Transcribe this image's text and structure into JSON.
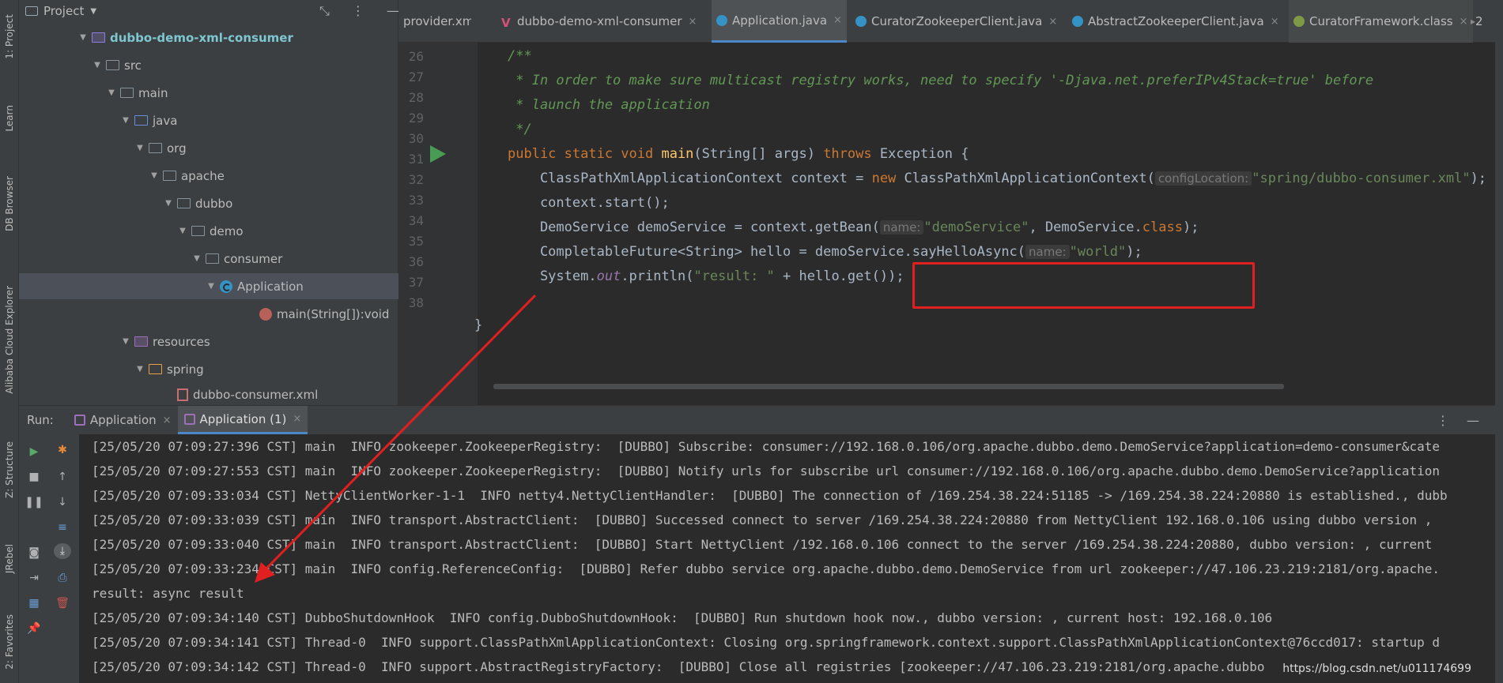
{
  "left_strip": {
    "tabs": [
      "1: Project",
      "Learn",
      "DB Browser",
      "Alibaba Cloud Explorer",
      "Z: Structure",
      "JRebel",
      "2: Favorites"
    ]
  },
  "project": {
    "title": "Project",
    "tree": [
      {
        "label": "dubbo-demo-xml-consumer",
        "kind": "module"
      },
      {
        "label": "src",
        "kind": "folder"
      },
      {
        "label": "main",
        "kind": "folder"
      },
      {
        "label": "java",
        "kind": "blue"
      },
      {
        "label": "org",
        "kind": "folder"
      },
      {
        "label": "apache",
        "kind": "folder"
      },
      {
        "label": "dubbo",
        "kind": "folder"
      },
      {
        "label": "demo",
        "kind": "folder"
      },
      {
        "label": "consumer",
        "kind": "folder"
      },
      {
        "label": "Application",
        "kind": "class"
      },
      {
        "label": "main(String[]):void",
        "kind": "method"
      },
      {
        "label": "resources",
        "kind": "resources"
      },
      {
        "label": "spring",
        "kind": "orange"
      },
      {
        "label": "dubbo-consumer.xml",
        "kind": "xml"
      }
    ]
  },
  "editor": {
    "tabs": [
      {
        "label": "provider.xml",
        "active": false
      },
      {
        "label": "dubbo-demo-xml-consumer",
        "active": false
      },
      {
        "label": "Application.java",
        "active": true
      },
      {
        "label": "CuratorZookeeperClient.java",
        "active": false
      },
      {
        "label": "AbstractZookeeperClient.java",
        "active": false
      },
      {
        "label": "CuratorFramework.class",
        "active": false
      }
    ],
    "overflow_label": "2",
    "line_numbers": [
      "26",
      "27",
      "28",
      "29",
      "30",
      "31",
      "32",
      "33",
      "34",
      "35",
      "36",
      "37",
      "38"
    ],
    "code": {
      "l26": "/**",
      "l27": " * In order to make sure multicast registry works, need to specify '-Djava.net.preferIPv4Stack=true' before",
      "l28": " * launch the application",
      "l29": " */",
      "l30_kw": "public static void ",
      "l30_fn": "main",
      "l30_rest": "(String[] args) ",
      "l30_kw2": "throws ",
      "l30_end": "Exception {",
      "l31_a": "    ClassPathXmlApplicationContext context = ",
      "l31_kw": "new ",
      "l31_b": "ClassPathXmlApplicationContext(",
      "l31_hint": "configLocation:",
      "l31_str": "\"spring/dubbo-consumer.xml\"",
      "l31_end": ");",
      "l32": "    context.start();",
      "l33_a": "    DemoService demoService = context.getBean(",
      "l33_hint": "name:",
      "l33_str": "\"demoService\"",
      "l33_b": ", DemoService.",
      "l33_kw": "class",
      "l33_end": ");",
      "l34_a": "    CompletableFuture<String> hello = demoService.sayHelloAsync(",
      "l34_hint": "name:",
      "l34_str": "\"world\"",
      "l34_end": ");",
      "l35_a": "    System.",
      "l35_field": "out",
      "l35_b": ".println(",
      "l35_str": "\"result: \"",
      "l35_end": " + hello.get());",
      "l37": "}"
    }
  },
  "run": {
    "label": "Run:",
    "tabs": [
      {
        "label": "Application",
        "active": false
      },
      {
        "label": "Application (1)",
        "active": true
      }
    ],
    "log": [
      "[25/05/20 07:09:27:396 CST] main  INFO zookeeper.ZookeeperRegistry:  [DUBBO] Subscribe: consumer://192.168.0.106/org.apache.dubbo.demo.DemoService?application=demo-consumer&cate",
      "[25/05/20 07:09:27:553 CST] main  INFO zookeeper.ZookeeperRegistry:  [DUBBO] Notify urls for subscribe url consumer://192.168.0.106/org.apache.dubbo.demo.DemoService?application",
      "[25/05/20 07:09:33:034 CST] NettyClientWorker-1-1  INFO netty4.NettyClientHandler:  [DUBBO] The connection of /169.254.38.224:51185 -> /169.254.38.224:20880 is established., dubb",
      "[25/05/20 07:09:33:039 CST] main  INFO transport.AbstractClient:  [DUBBO] Successed connect to server /169.254.38.224:20880 from NettyClient 192.168.0.106 using dubbo version ,",
      "[25/05/20 07:09:33:040 CST] main  INFO transport.AbstractClient:  [DUBBO] Start NettyClient /192.168.0.106 connect to the server /169.254.38.224:20880, dubbo version: , current",
      "[25/05/20 07:09:33:234 CST] main  INFO config.ReferenceConfig:  [DUBBO] Refer dubbo service org.apache.dubbo.demo.DemoService from url zookeeper://47.106.23.219:2181/org.apache.",
      "result: async result",
      "[25/05/20 07:09:34:140 CST] DubboShutdownHook  INFO config.DubboShutdownHook:  [DUBBO] Run shutdown hook now., dubbo version: , current host: 192.168.0.106",
      "[25/05/20 07:09:34:141 CST] Thread-0  INFO support.ClassPathXmlApplicationContext: Closing org.springframework.context.support.ClassPathXmlApplicationContext@76ccd017: startup d",
      "[25/05/20 07:09:34:142 CST] Thread-0  INFO support.AbstractRegistryFactory:  [DUBBO] Close all registries [zookeeper://47.106.23.219:2181/org.apache.dubbo"
    ],
    "watermark": "https://blog.csdn.net/u011174699"
  },
  "colors": {
    "annotation_red": "#e02020",
    "run_green": "#499c54"
  }
}
